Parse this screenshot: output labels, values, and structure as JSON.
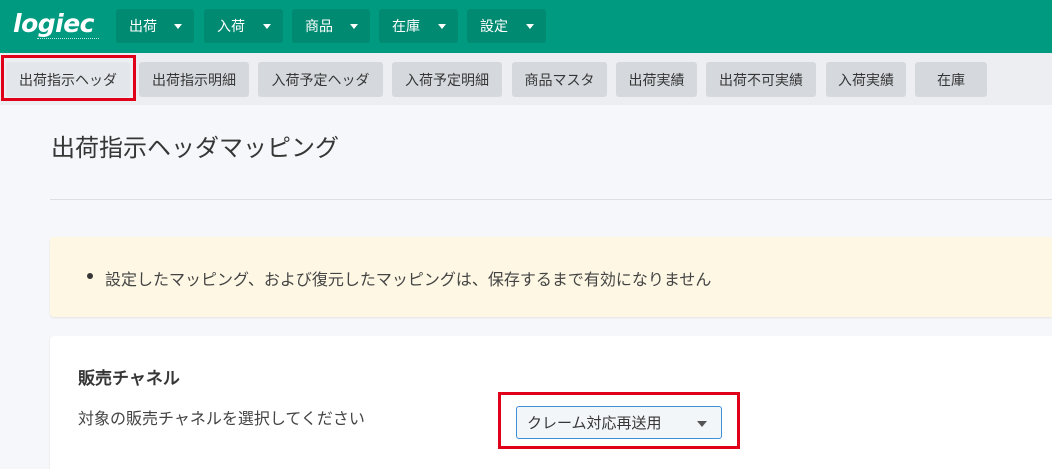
{
  "brand": {
    "logo_text": "logiec"
  },
  "topnav": {
    "items": [
      {
        "label": "出荷"
      },
      {
        "label": "入荷"
      },
      {
        "label": "商品"
      },
      {
        "label": "在庫"
      },
      {
        "label": "設定"
      }
    ]
  },
  "subnav": {
    "tabs": [
      {
        "label": "出荷指示ヘッダ",
        "active": true
      },
      {
        "label": "出荷指示明細"
      },
      {
        "label": "入荷予定ヘッダ"
      },
      {
        "label": "入荷予定明細"
      },
      {
        "label": "商品マスタ"
      },
      {
        "label": "出荷実績"
      },
      {
        "label": "出荷不可実績"
      },
      {
        "label": "入荷実績"
      },
      {
        "label": "在庫"
      }
    ]
  },
  "page": {
    "title": "出荷指示ヘッダマッピング"
  },
  "notice": {
    "text": "設定したマッピング、および復元したマッピングは、保存するまで有効になりません"
  },
  "sales_channel": {
    "label": "販売チャネル",
    "help": "対象の販売チャネルを選択してください",
    "selected": "クレーム対応再送用"
  },
  "colors": {
    "topbar": "#009a80",
    "topnav_button": "#008a72",
    "highlight": "#e0001a",
    "notice_bg": "#fdf7e4",
    "select_border": "#3f8ed8"
  }
}
